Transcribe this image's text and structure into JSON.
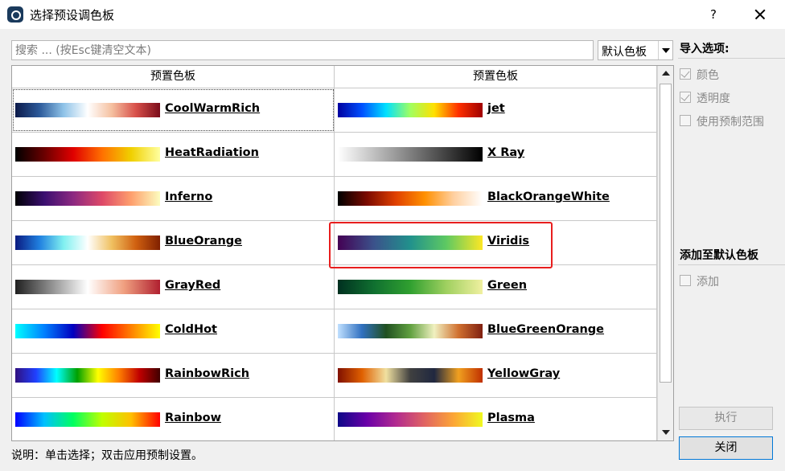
{
  "window": {
    "title": "选择预设调色板",
    "help_label": "?"
  },
  "search": {
    "placeholder": "搜索 ... (按Esc键清空文本)",
    "value": ""
  },
  "palette_filter": {
    "selected": "默认色板"
  },
  "grid": {
    "headers": [
      "预置色板",
      "预置色板"
    ],
    "rows": [
      {
        "left": {
          "name": "CoolWarmRich",
          "gradient": [
            "#0c1a4a",
            "#2c5a9a",
            "#8fc3e8",
            "#ffffff",
            "#f5c0a0",
            "#d8504a",
            "#7a0c1a"
          ],
          "focused": true
        },
        "right": {
          "name": "jet",
          "gradient": [
            "#0000a0",
            "#0050ff",
            "#00e0ff",
            "#a0ff60",
            "#ffe000",
            "#ff3000",
            "#a00000"
          ]
        }
      },
      {
        "left": {
          "name": "HeatRadiation",
          "gradient": [
            "#000000",
            "#6a0000",
            "#e00000",
            "#ff7000",
            "#f0d000",
            "#ffffa0"
          ]
        },
        "right": {
          "name": "X Ray",
          "gradient": [
            "#ffffff",
            "#c0c0c0",
            "#808080",
            "#404040",
            "#000000"
          ]
        }
      },
      {
        "left": {
          "name": "Inferno",
          "gradient": [
            "#000004",
            "#3b0f70",
            "#8c2981",
            "#de4968",
            "#fe9f6d",
            "#fcfdbf"
          ]
        },
        "right": {
          "name": "BlackOrangeWhite",
          "gradient": [
            "#000000",
            "#7a0a00",
            "#e04000",
            "#ff9000",
            "#ffd0a0",
            "#ffffff"
          ]
        }
      },
      {
        "left": {
          "name": "BlueOrange",
          "gradient": [
            "#0a1a80",
            "#2080e0",
            "#80f0f0",
            "#ffffff",
            "#f0c060",
            "#d06010",
            "#802000"
          ]
        },
        "right": {
          "name": "Viridis",
          "gradient": [
            "#440154",
            "#3b528b",
            "#21918c",
            "#5ec962",
            "#fde725"
          ]
        }
      },
      {
        "left": {
          "name": "GrayRed",
          "gradient": [
            "#202020",
            "#909090",
            "#ffffff",
            "#f0a080",
            "#b02030"
          ]
        },
        "right": {
          "name": "Green",
          "gradient": [
            "#003020",
            "#107030",
            "#30a030",
            "#a0d060",
            "#f0f0a0"
          ]
        }
      },
      {
        "left": {
          "name": "ColdHot",
          "gradient": [
            "#00ffff",
            "#0080ff",
            "#0000c0",
            "#ff0000",
            "#ff8000",
            "#ffff00"
          ]
        },
        "right": {
          "name": "BlueGreenOrange",
          "gradient": [
            "#c0e0ff",
            "#3070c0",
            "#205020",
            "#60a040",
            "#f0f0c0",
            "#d07030",
            "#802010"
          ]
        }
      },
      {
        "left": {
          "name": "RainbowRich",
          "gradient": [
            "#301080",
            "#2040ff",
            "#00ffff",
            "#00a000",
            "#ffff00",
            "#ff8000",
            "#c00000",
            "#400000"
          ]
        },
        "right": {
          "name": "YellowGray",
          "gradient": [
            "#801000",
            "#e06000",
            "#f0e0a0",
            "#404040",
            "#202840",
            "#f0a020",
            "#c03000"
          ]
        }
      },
      {
        "left": {
          "name": "Rainbow",
          "gradient": [
            "#0000ff",
            "#00c0ff",
            "#00ff60",
            "#c0ff00",
            "#ffc000",
            "#ff0000"
          ]
        },
        "right": {
          "name": "Plasma",
          "gradient": [
            "#0d0887",
            "#6a00a8",
            "#b12a90",
            "#e16462",
            "#fca636",
            "#f0f921"
          ]
        }
      }
    ]
  },
  "import_options": {
    "heading": "导入选项:",
    "color": {
      "label": "颜色",
      "checked": true
    },
    "opacity": {
      "label": "透明度",
      "checked": true
    },
    "use_preset_range": {
      "label": "使用预制范围",
      "checked": false
    }
  },
  "add_default": {
    "heading": "添加至默认色板",
    "add": {
      "label": "添加",
      "checked": false
    }
  },
  "buttons": {
    "run": "执行",
    "close": "关闭"
  },
  "hint": "说明：单击选择；双击应用预制设置。",
  "colors": {
    "highlight": "#e81e1e",
    "focus_border": "#0078d7"
  }
}
